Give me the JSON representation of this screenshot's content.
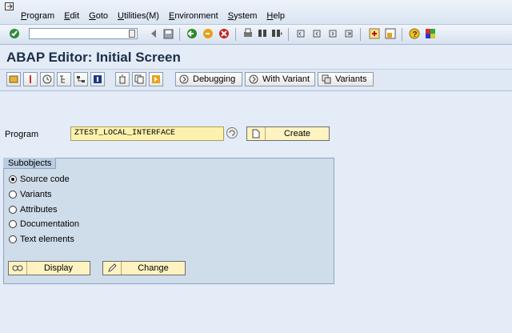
{
  "menu": {
    "items": [
      "Program",
      "Edit",
      "Goto",
      "Utilities(M)",
      "Environment",
      "System",
      "Help"
    ]
  },
  "toolbar": {
    "command_field_value": "",
    "icons": [
      "enter-icon",
      "save-icon",
      "back-icon",
      "exit-icon",
      "cancel-icon",
      "print-icon",
      "find-icon",
      "find-next-icon",
      "first-page-icon",
      "prev-page-icon",
      "next-page-icon",
      "last-page-icon",
      "create-session-icon",
      "shortcut-icon",
      "help-icon",
      "layout-icon"
    ]
  },
  "screen": {
    "title": "ABAP Editor: Initial Screen"
  },
  "app_toolbar": {
    "debugging_label": "Debugging",
    "with_variant_label": "With Variant",
    "variants_label": "Variants"
  },
  "program": {
    "label": "Program",
    "value": "ZTEST_LOCAL_INTERFACE",
    "create_label": "Create"
  },
  "subobjects": {
    "title": "Subobjects",
    "options": [
      {
        "label": "Source code",
        "selected": true
      },
      {
        "label": "Variants",
        "selected": false
      },
      {
        "label": "Attributes",
        "selected": false
      },
      {
        "label": "Documentation",
        "selected": false
      },
      {
        "label": "Text elements",
        "selected": false
      }
    ],
    "display_label": "Display",
    "change_label": "Change"
  },
  "colors": {
    "background": "#e3ecf7",
    "input_yellow": "#fcf2ad",
    "group_bg": "#cfdcea",
    "title_text": "#1e2e48"
  }
}
